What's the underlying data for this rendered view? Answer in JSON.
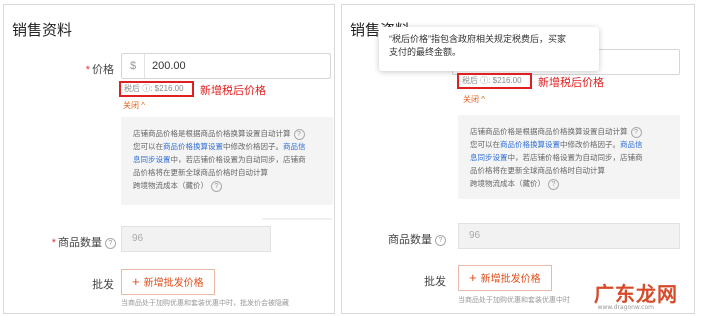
{
  "left": {
    "section_title": "销售资料",
    "price_label": "价格",
    "required_mark": "*",
    "currency": "$",
    "price_value": "200.00",
    "tax_price": "税后 ⓘ: $216.00",
    "tax_note": "新增税后价格",
    "collapse": "关闭 ^",
    "info": {
      "line1": "店铺商品价格是根据商品价格换算设置自动计算",
      "line2_pre": "您可以在",
      "line2_link": "商品价格换算设置",
      "line2_mid": "中修改价格因子。",
      "line2_link2": "商品信",
      "line3_link": "息同步设置",
      "line3_post": "中，若店铺价格设置为自动同步，店铺商",
      "line4": "品价格将在更新全球商品价格时自动计算",
      "line5": "跨境物流成本（藏价）"
    },
    "qty_label": "商品数量",
    "qty_value": "96",
    "wholesale_label": "批发",
    "add_wholesale": "新增批发价格",
    "hint": "当商品处于加购优惠和套装优惠中时，批发价会被隐藏"
  },
  "right": {
    "section_title": "销售资料",
    "tooltip_line1": "“税后价格”指包含政府相关规定税费后，买家",
    "tooltip_line2": "支付的最终金额。",
    "tax_price": "税后 ⓘ: $216.00",
    "tax_note": "新增税后价格",
    "collapse": "关闭 ^",
    "info": {
      "line1": "店铺商品价格是根据商品价格换算设置自动计算",
      "line2_pre": "您可以在",
      "line2_link": "商品价格换算设置",
      "line2_mid": "中修改价格因子。",
      "line2_link2": "商品信",
      "line3_link": "息同步设置",
      "line3_post": "中，若店铺价格设置为自动同步，店铺商",
      "line4": "品价格将在更新全球商品价格时自动计算",
      "line5": "跨境物流成本（藏价）"
    },
    "qty_label": "商品数量",
    "qty_value": "96",
    "wholesale_label": "批发",
    "add_wholesale": "新增批发价格",
    "hint": "当商品处于加购优惠和套装优惠中时"
  },
  "watermark": {
    "text": "广东龙网",
    "url": "www.dragonw.com"
  },
  "colors": {
    "accent_red": "#e02020",
    "link_blue": "#2f6fd6",
    "orange": "#e04e1b"
  }
}
